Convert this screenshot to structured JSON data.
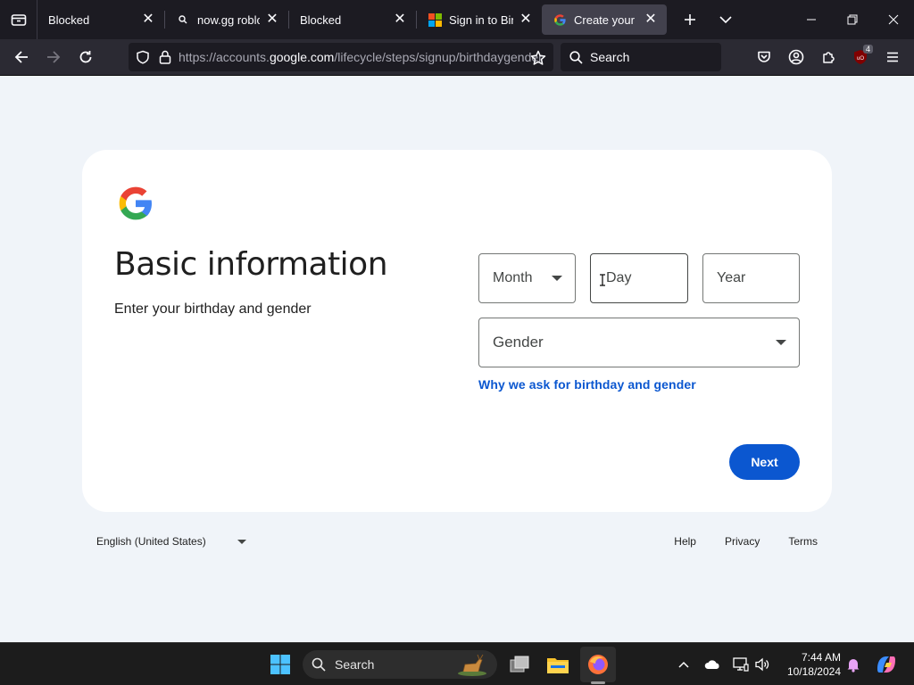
{
  "browser": {
    "tabs": [
      {
        "title": "Blocked",
        "icon": "none",
        "active": false
      },
      {
        "title": "now.gg roblox -",
        "icon": "search-icon",
        "active": false
      },
      {
        "title": "Blocked",
        "icon": "none",
        "active": false
      },
      {
        "title": "Sign in to Bing",
        "icon": "microsoft-logo-icon",
        "active": false
      },
      {
        "title": "Create your Goo",
        "icon": "google-logo-icon",
        "active": true
      }
    ],
    "url_prefix": "https://accounts.",
    "url_domain": "google.com",
    "url_path": "/lifecycle/steps/signup/birthdaygender",
    "search_placeholder": "Search",
    "ublock_count": "4"
  },
  "page": {
    "title": "Basic information",
    "subtitle": "Enter your birthday and gender",
    "month_placeholder": "Month",
    "day_placeholder": "Day",
    "year_placeholder": "Year",
    "gender_placeholder": "Gender",
    "why_link": "Why we ask for birthday and gender",
    "next_label": "Next"
  },
  "footer": {
    "language": "English (United States)",
    "help": "Help",
    "privacy": "Privacy",
    "terms": "Terms"
  },
  "taskbar": {
    "search_label": "Search",
    "time": "7:44 AM",
    "date": "10/18/2024"
  },
  "colors": {
    "accent": "#0b57d0",
    "page_bg": "#f0f4f9",
    "chrome_dark": "#1c1b22"
  }
}
